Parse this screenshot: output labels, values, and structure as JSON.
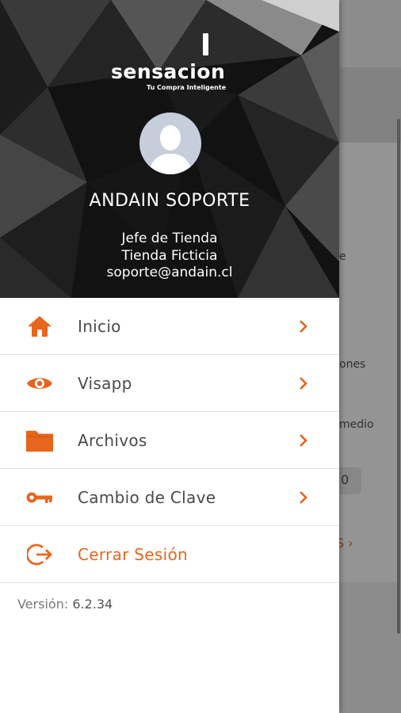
{
  "background": {
    "snippets": [
      "e",
      "ones",
      "medio",
      "0",
      "S ›"
    ]
  },
  "header": {
    "logo_text": "sensacion",
    "logo_tagline": "Tu Compra Inteligente",
    "user_name": "ANDAIN SOPORTE",
    "role": "Jefe de Tienda",
    "store": "Tienda Ficticia",
    "email": "soporte@andain.cl"
  },
  "menu": {
    "items": [
      {
        "label": "Inicio",
        "icon": "home-icon"
      },
      {
        "label": "Visapp",
        "icon": "eye-icon"
      },
      {
        "label": "Archivos",
        "icon": "folder-icon"
      },
      {
        "label": "Cambio de Clave",
        "icon": "key-icon"
      }
    ],
    "logout": {
      "label": "Cerrar Sesión",
      "icon": "logout-icon"
    }
  },
  "footer": {
    "version_label": "Versión:",
    "version_value": "6.2.34"
  },
  "colors": {
    "accent": "#e8651d",
    "header_bg": "#111111",
    "avatar_bg": "#c6cedc"
  }
}
